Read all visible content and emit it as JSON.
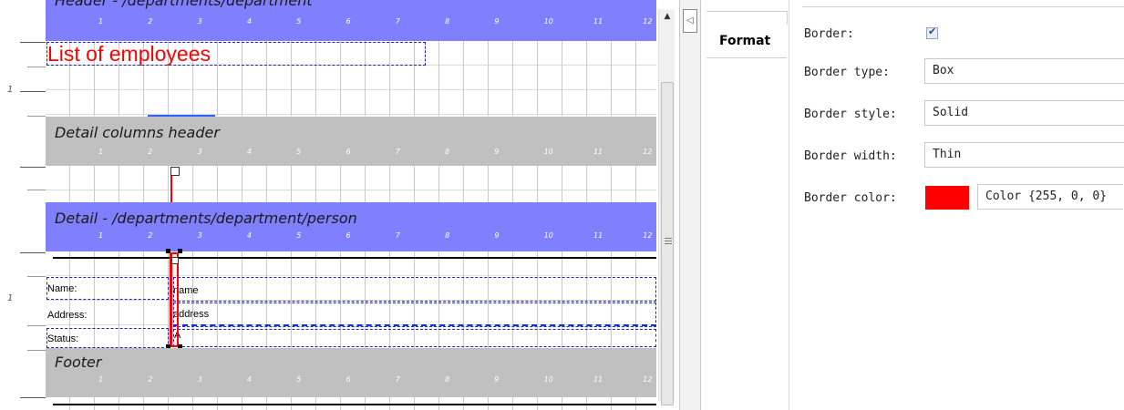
{
  "designer": {
    "header_band": {
      "title": "Header - /departments/department",
      "color": "#8080ff"
    },
    "report_title": {
      "text": "List of employees",
      "color": "#ff0000"
    },
    "detail_columns_band": {
      "title": "Detail columns header",
      "color": "#c0c0c0"
    },
    "detail_band": {
      "title": "Detail - /departments/department/person",
      "color": "#8080ff"
    },
    "footer_band": {
      "title": "Footer",
      "color": "#c0c0c0"
    },
    "ruler_numbers": [
      "1",
      "2",
      "3",
      "4",
      "5",
      "6",
      "7",
      "8",
      "9",
      "10",
      "11",
      "12"
    ],
    "vertical_ruler_marks": [
      "1",
      "1"
    ],
    "fields": {
      "name_label": "Name:",
      "name_value": "name",
      "address_label": "Address:",
      "address_value": "address",
      "status_label": "Status:",
      "status_value": "A"
    }
  },
  "tabs": {
    "format": "Format"
  },
  "properties": {
    "border_label": "Border:",
    "border_checked": true,
    "border_type_label": "Border type:",
    "border_type_value": "Box",
    "border_style_label": "Border style:",
    "border_style_value": "Solid",
    "border_width_label": "Border width:",
    "border_width_value": "Thin",
    "border_color_label": "Border color:",
    "border_color_swatch": "#ff0000",
    "border_color_value": "Color {255, 0, 0}"
  }
}
